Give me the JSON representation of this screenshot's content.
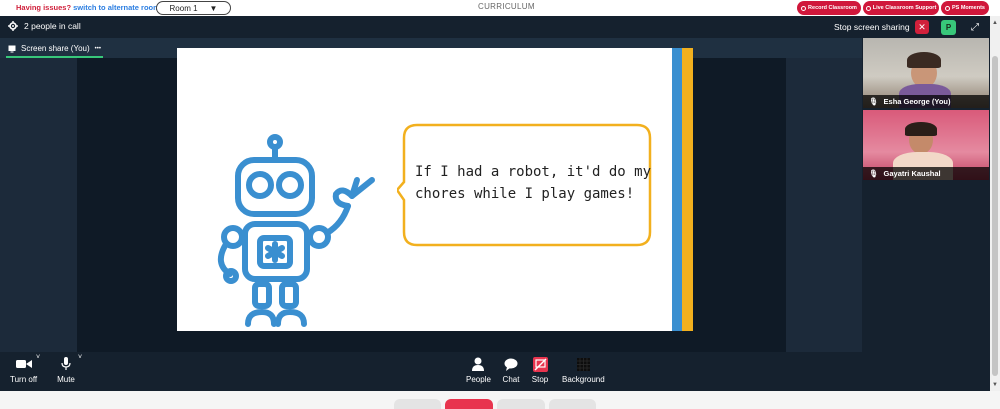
{
  "topbar": {
    "issue_prefix": "Having issues?",
    "issue_link": "switch to alternate room",
    "room_label": "Room 1",
    "center_title": "CURRICULUM",
    "pills": [
      "Record Classroom",
      "Live Classroom Support",
      "PS Moments"
    ]
  },
  "header": {
    "people_count": "2 people in call",
    "stop_sharing": "Stop screen sharing",
    "close_glyph": "✕",
    "profile_initial": "P",
    "fullscreen_glyph": "⤢"
  },
  "subheader": {
    "tab_label": "Screen share (You)",
    "more_glyph": "•••"
  },
  "slide": {
    "line1": "If I had a robot, it'd do my",
    "line2": "chores while I play games!"
  },
  "participants": [
    {
      "name": "Esha George (You)",
      "icon": "mic-icon"
    },
    {
      "name": "Gayatri Kaushal",
      "icon": "mic-icon"
    }
  ],
  "controls": {
    "turn_off": "Turn off",
    "mute": "Mute",
    "people": "People",
    "chat": "Chat",
    "stop": "Stop",
    "background": "Background"
  },
  "colors": {
    "brand_red": "#d0203b",
    "accent_green": "#38c77a",
    "robot_blue": "#3a8fd0",
    "bubble_yellow": "#f2b01e"
  }
}
